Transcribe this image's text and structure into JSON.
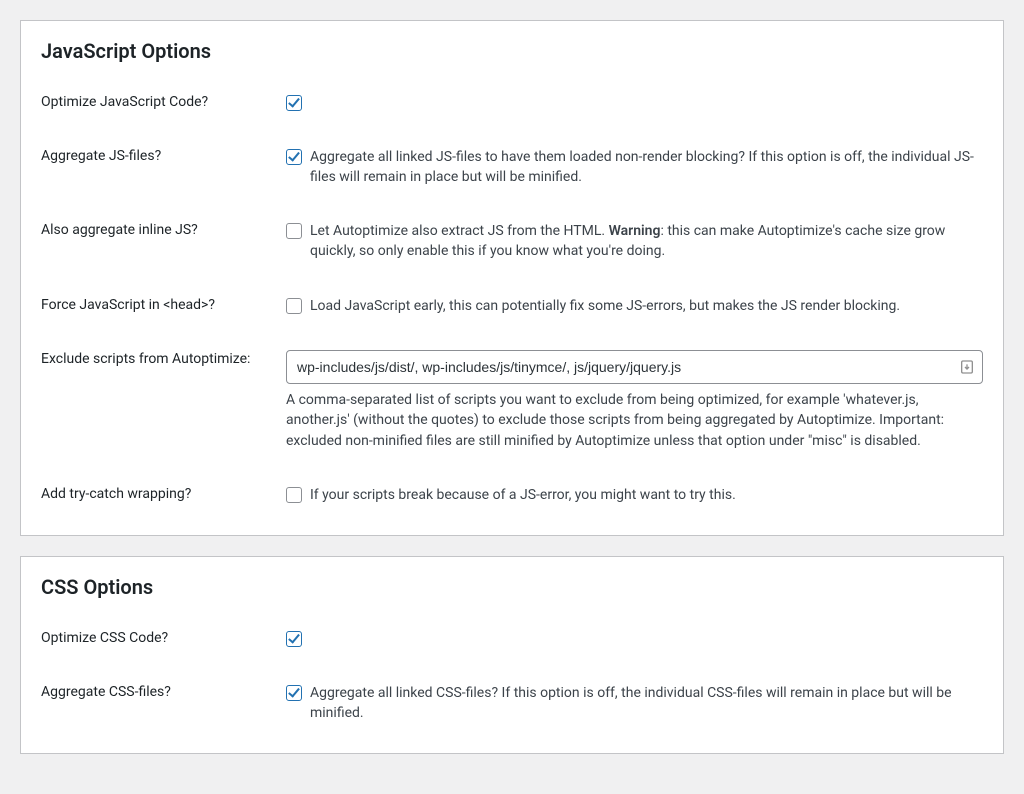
{
  "js": {
    "title": "JavaScript Options",
    "optimize": {
      "label": "Optimize JavaScript Code?",
      "checked": true
    },
    "aggregate": {
      "label": "Aggregate JS-files?",
      "checked": true,
      "desc": "Aggregate all linked JS-files to have them loaded non-render blocking? If this option is off, the individual JS-files will remain in place but will be minified."
    },
    "inline": {
      "label": "Also aggregate inline JS?",
      "checked": false,
      "desc_before": "Let Autoptimize also extract JS from the HTML. ",
      "desc_strong": "Warning",
      "desc_after": ": this can make Autoptimize's cache size grow quickly, so only enable this if you know what you're doing."
    },
    "forcehead": {
      "label": "Force JavaScript in <head>?",
      "checked": false,
      "desc": "Load JavaScript early, this can potentially fix some JS-errors, but makes the JS render blocking."
    },
    "exclude": {
      "label": "Exclude scripts from Autoptimize:",
      "value": "wp-includes/js/dist/, wp-includes/js/tinymce/, js/jquery/jquery.js",
      "help": "A comma-separated list of scripts you want to exclude from being optimized, for example 'whatever.js, another.js' (without the quotes) to exclude those scripts from being aggregated by Autoptimize. Important: excluded non-minified files are still minified by Autoptimize unless that option under \"misc\" is disabled."
    },
    "trycatch": {
      "label": "Add try-catch wrapping?",
      "checked": false,
      "desc": "If your scripts break because of a JS-error, you might want to try this."
    }
  },
  "css": {
    "title": "CSS Options",
    "optimize": {
      "label": "Optimize CSS Code?",
      "checked": true
    },
    "aggregate": {
      "label": "Aggregate CSS-files?",
      "checked": true,
      "desc": "Aggregate all linked CSS-files? If this option is off, the individual CSS-files will remain in place but will be minified."
    }
  }
}
